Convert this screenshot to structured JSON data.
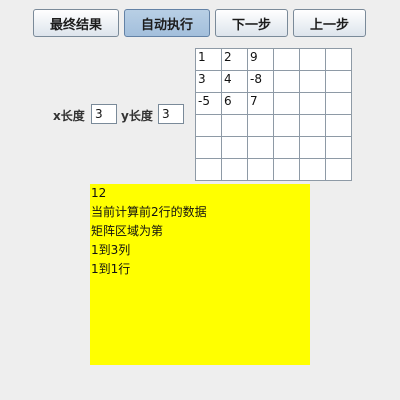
{
  "toolbar": {
    "final_result": "最终结果",
    "auto_run": "自动执行",
    "next_step": "下一步",
    "prev_step": "上一步"
  },
  "params": {
    "x_label": "x长度",
    "x_value": "3",
    "y_label": "y长度",
    "y_value": "3"
  },
  "matrix": [
    [
      "1",
      "2",
      "9",
      "",
      "",
      ""
    ],
    [
      "3",
      "4",
      "-8",
      "",
      "",
      ""
    ],
    [
      "-5",
      "6",
      "7",
      "",
      "",
      ""
    ],
    [
      "",
      "",
      "",
      "",
      "",
      ""
    ],
    [
      "",
      "",
      "",
      "",
      "",
      ""
    ],
    [
      "",
      "",
      "",
      "",
      "",
      ""
    ]
  ],
  "output": {
    "lines": [
      "12",
      "当前计算前2行的数据",
      "矩阵区域为第",
      "1到3列",
      "1到1行"
    ]
  },
  "colors": {
    "output_bg": "#ffff00",
    "pressed_button": "#a3bfdc"
  }
}
